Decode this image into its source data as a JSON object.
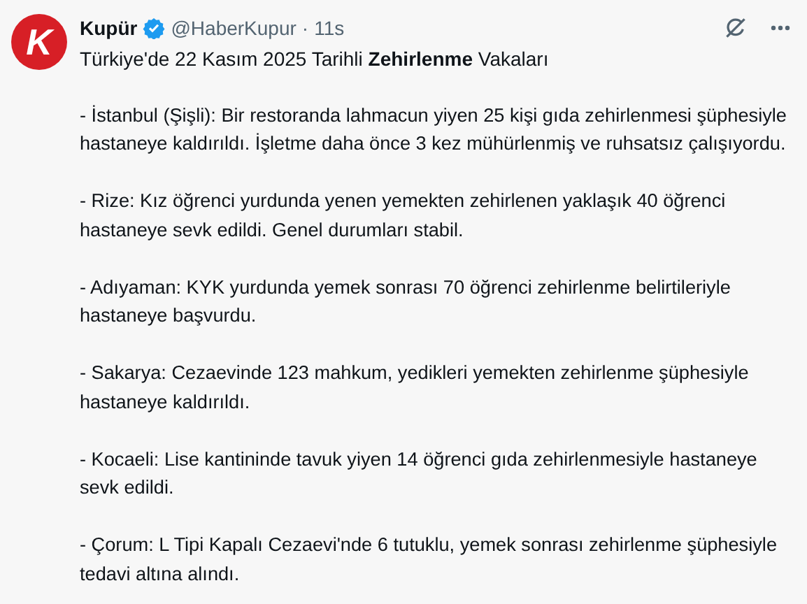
{
  "post": {
    "avatar_letter": "K",
    "author": "Kupür",
    "verified": true,
    "handle": "@HaberKupur",
    "separator": "·",
    "time": "11s",
    "title": "Türkiye'de 22 Kasım 2025 Tarihli **Zehirlenme** Vakaları",
    "paragraphs": [
      "- İstanbul (Şişli): Bir restoranda lahmacun yiyen 25 kişi gıda zehirlenmesi şüphesiyle hastaneye kaldırıldı. İşletme daha önce 3 kez mühürlenmiş ve ruhsatsız çalışıyordu.",
      "- Rize: Kız öğrenci yurdunda yenen yemekten zehirlenen yaklaşık 40 öğrenci hastaneye sevk edildi. Genel durumları stabil.",
      "- Adıyaman: KYK yurdunda yemek sonrası 70 öğrenci zehirlenme belirtileriyle hastaneye başvurdu.",
      "- Sakarya: Cezaevinde 123 mahkum, yedikleri yemekten zehirlenme şüphesiyle hastaneye kaldırıldı.",
      "- Kocaeli: Lise kantininde tavuk yiyen 14 öğrenci gıda zehirlenmesiyle hastaneye sevk edildi.",
      "- Çorum: L Tipi Kapalı Cezaevi'nde 6 tutuklu, yemek sonrası zehirlenme şüphesiyle tedavi altına alındı."
    ]
  }
}
